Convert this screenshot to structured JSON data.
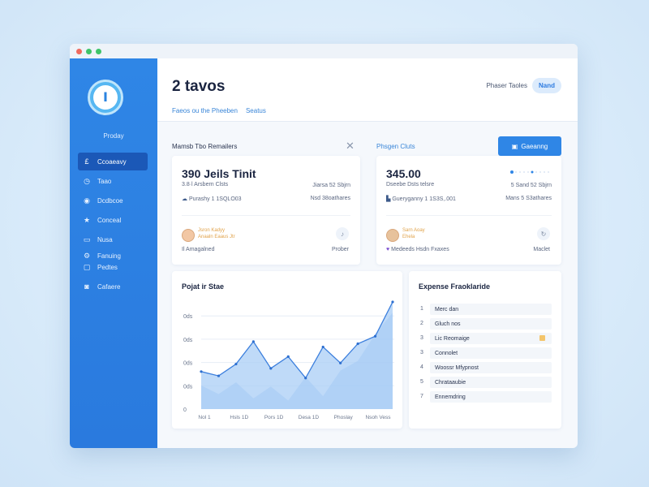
{
  "window": {
    "controls": [
      "close",
      "minimize",
      "maximize"
    ]
  },
  "colors": {
    "sidebar": "#2f86e6",
    "accent": "#2f86e6",
    "active_nav": "#1b58b7",
    "chart_fill": "#a9cdf5",
    "chart_line": "#3c7fdd"
  },
  "sidebar": {
    "brand": "Proday",
    "items": [
      {
        "label": "Ccoaeavy",
        "icon": "dollar-icon",
        "active": true
      },
      {
        "label": "Taao",
        "icon": "clock-icon"
      },
      {
        "label": "Dcdbcoe",
        "icon": "circle-icon"
      },
      {
        "label": "Conceal",
        "icon": "star-icon"
      },
      {
        "label": "Nusa",
        "icon": "monitor-icon"
      },
      {
        "label": "Fanuing",
        "icon": "gear-icon"
      },
      {
        "label": "Pedtes",
        "icon": "box-icon"
      },
      {
        "label": "Cafaere",
        "icon": "box-icon"
      }
    ]
  },
  "header": {
    "title": "2 tavos",
    "breadcrumbs": [
      "Faeos ou the Pheeben",
      "Seatus"
    ],
    "right_label": "Phaser Taoles",
    "pill_label": "Nand"
  },
  "section_left": {
    "label": "Mamsb Tbo Remailers"
  },
  "section_right": {
    "label": "Phsgen Cluts",
    "button_label": "Gaeanng"
  },
  "card1": {
    "title": "390 Jeils Tinit",
    "sub": "3.8·l Arsbern Clsts",
    "right1": "Jiarsa 52 Sbjrn",
    "line2": "Purashy 1 1SQLO03",
    "right2": "Nsd 38oathares",
    "person_name": "Jsron Kadyy",
    "person_tag": "Anaaln Eaaus Jtr",
    "foot_left": "Il Amagalned",
    "foot_right": "Prober"
  },
  "card2": {
    "title": "345.00",
    "sub": "Dseebe Dsts telsre",
    "right1": "5 Sand 52 Sbjrn",
    "line2": "Gueryganny 1 1S3S,.001",
    "right2": "Mans 5 S3athares",
    "person_name": "Sarn Aoay",
    "person_tag": "Ehela",
    "foot_left": "Medeeds Hsdn Fxaxes",
    "foot_right": "Maclet"
  },
  "chart_panel": {
    "title": "Pojat ir Stae"
  },
  "chart_data": {
    "type": "area",
    "title": "Pojat ir Stae",
    "categories": [
      "Nol 1",
      "Hsls 1D",
      "Pors 1D",
      "Desa 1D",
      "Phoslay",
      "Nsoh Vess"
    ],
    "y_tick_labels": [
      "0",
      "0ds",
      "0ds",
      "0ds",
      "0ds"
    ],
    "xlabel": "",
    "ylabel": "",
    "ylim": [
      0,
      100
    ],
    "series": [
      {
        "values": [
          35,
          31,
          42,
          63,
          38,
          49,
          29,
          58,
          43,
          61,
          68,
          100
        ],
        "style": "line-area"
      },
      {
        "values": [
          22,
          14,
          25,
          10,
          21,
          8,
          30,
          12,
          36,
          45,
          70,
          90
        ],
        "style": "back-area"
      }
    ],
    "grid": true
  },
  "expense": {
    "title": "Expense Fraoklaride",
    "rows": [
      {
        "num": "1",
        "label": "Merc dan"
      },
      {
        "num": "2",
        "label": "Gluch nos"
      },
      {
        "num": "3",
        "label": "Lic Reomaige",
        "flag": true
      },
      {
        "num": "3",
        "label": "Connolet"
      },
      {
        "num": "4",
        "label": "Woossr Mfypnost"
      },
      {
        "num": "5",
        "label": "Chrataaubie"
      },
      {
        "num": "7",
        "label": "Ennemdring"
      }
    ]
  }
}
